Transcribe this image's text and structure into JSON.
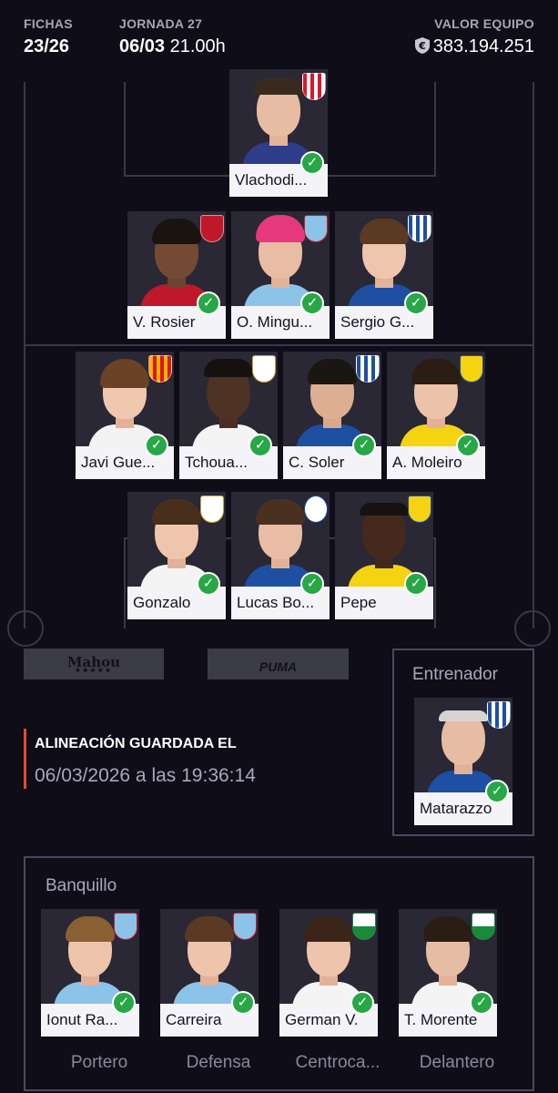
{
  "header": {
    "fichas_label": "FICHAS",
    "fichas_value": "23/26",
    "jornada_label": "JORNADA 27",
    "jornada_date": "06/03",
    "jornada_time": "21.00h",
    "valor_label": "VALOR EQUIPO",
    "valor_icon": "euro-shield-icon",
    "valor_value": "383.194.251"
  },
  "lineup": {
    "goalkeeper": [
      {
        "name": "Vlachodi...",
        "club": "Sevilla",
        "confirmed": true
      }
    ],
    "defense": [
      {
        "name": "V. Rosier",
        "club": "Osasuna",
        "confirmed": true
      },
      {
        "name": "O. Mingu...",
        "club": "Celta",
        "confirmed": true
      },
      {
        "name": "Sergio G...",
        "club": "Real Sociedad",
        "confirmed": true
      }
    ],
    "midfield": [
      {
        "name": "Javi Gue...",
        "club": "Valencia",
        "confirmed": true
      },
      {
        "name": "Tchoua...",
        "club": "Real Madrid",
        "confirmed": true
      },
      {
        "name": "C. Soler",
        "club": "Real Sociedad",
        "confirmed": true
      },
      {
        "name": "A. Moleiro",
        "club": "Villarreal",
        "confirmed": true
      }
    ],
    "attack": [
      {
        "name": "Gonzalo",
        "club": "Real Madrid",
        "confirmed": true
      },
      {
        "name": "Lucas Bo...",
        "club": "Alaves",
        "confirmed": true
      },
      {
        "name": "Pepe",
        "club": "Villarreal",
        "confirmed": true
      }
    ]
  },
  "sponsors": [
    "Mahou",
    "PUMA"
  ],
  "coach": {
    "title": "Entrenador",
    "name": "Matarazzo",
    "club": "Real Sociedad",
    "confirmed": true
  },
  "saved": {
    "label": "ALINEACIÓN GUARDADA EL",
    "value": "06/03/2026 a las 19:36:14"
  },
  "bench": {
    "title": "Banquillo",
    "players": [
      {
        "name": "Ionut Ra...",
        "club": "Celta",
        "position": "Portero",
        "confirmed": true
      },
      {
        "name": "Carreira",
        "club": "Celta",
        "position": "Defensa",
        "confirmed": true
      },
      {
        "name": "German V.",
        "club": "Elche",
        "position": "Centroca...",
        "confirmed": true
      },
      {
        "name": "T. Morente",
        "club": "Elche",
        "position": "Delantero",
        "confirmed": true
      }
    ]
  },
  "colors": {
    "background": "#0e0d18",
    "accent": "#e8492d",
    "check": "#27a745",
    "card_label": "#f4f3f7"
  }
}
